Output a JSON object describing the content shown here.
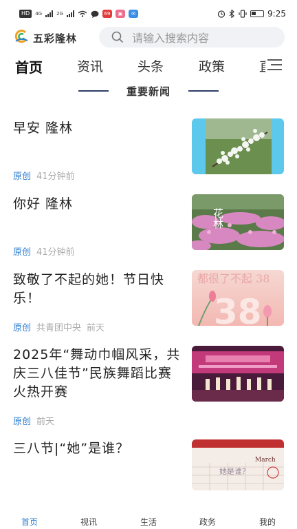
{
  "status_bar": {
    "chip": "HD",
    "net1": "4G",
    "net2": "2G",
    "app1": "69",
    "time": "9:25"
  },
  "header": {
    "brand": "五彩隆林",
    "search_placeholder": "请输入搜索内容"
  },
  "tabs": [
    {
      "label": "首页",
      "active": true
    },
    {
      "label": "资讯",
      "active": false
    },
    {
      "label": "头条",
      "active": false
    },
    {
      "label": "政策",
      "active": false
    },
    {
      "label": "直",
      "active": false
    }
  ],
  "section": {
    "title": "重要新闻"
  },
  "news": [
    {
      "title": "早安 隆林",
      "tag": "原创",
      "source": "",
      "time": "41分钟前",
      "thumb_text": ""
    },
    {
      "title": "你好 隆林",
      "tag": "原创",
      "source": "",
      "time": "41分钟前",
      "thumb_text": "花林"
    },
    {
      "title": "致敬了不起的她！节日快乐！",
      "tag": "原创",
      "source": "共青团中央",
      "time": "前天",
      "thumb_text": "都很了不起 38"
    },
    {
      "title": "2025年“舞动巾帼风采，共庆三八佳节”民族舞蹈比赛火热开赛",
      "tag": "原创",
      "source": "",
      "time": "前天",
      "thumb_text": ""
    },
    {
      "title": "三八节|“她”是谁？",
      "tag": "",
      "source": "",
      "time": "",
      "thumb_text": "她是谁？"
    }
  ],
  "bottom_nav": [
    {
      "label": "首页",
      "active": true
    },
    {
      "label": "视讯",
      "active": false
    },
    {
      "label": "生活",
      "active": false
    },
    {
      "label": "政务",
      "active": false
    },
    {
      "label": "我的",
      "active": false
    }
  ],
  "colors": {
    "accent": "#2f7fd0",
    "section_line": "#2c3e66",
    "search_bg": "#f1f2f5"
  }
}
